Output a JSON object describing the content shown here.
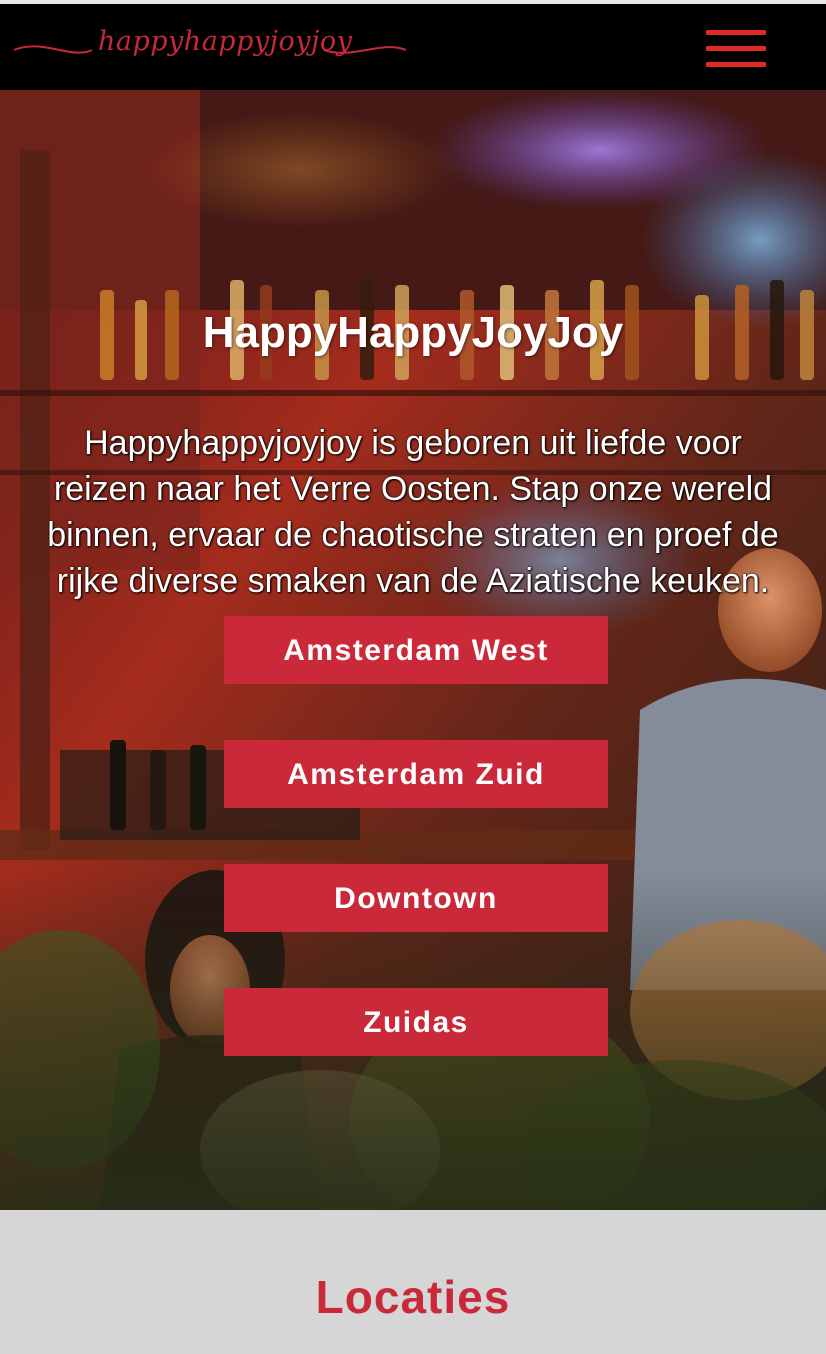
{
  "header": {
    "logo_text": "happyhappyjoyjoy",
    "menu_icon": "hamburger-icon"
  },
  "hero": {
    "title": "HappyHappyJoyJoy",
    "description": "Happyhappyjoyjoy is geboren uit liefde voor reizen naar het Verre Oosten. Stap onze wereld binnen, ervaar de chaotische straten en proef de rijke diverse smaken van de Aziatische keuken.",
    "locations": [
      {
        "label": "Amsterdam West"
      },
      {
        "label": "Amsterdam Zuid"
      },
      {
        "label": "Downtown"
      },
      {
        "label": "Zuidas"
      }
    ]
  },
  "section": {
    "title": "Locaties"
  },
  "colors": {
    "brand_red": "#c92939",
    "menu_red": "#e32b25",
    "header_bg": "#000000",
    "section_bg": "#d6d6d6"
  }
}
